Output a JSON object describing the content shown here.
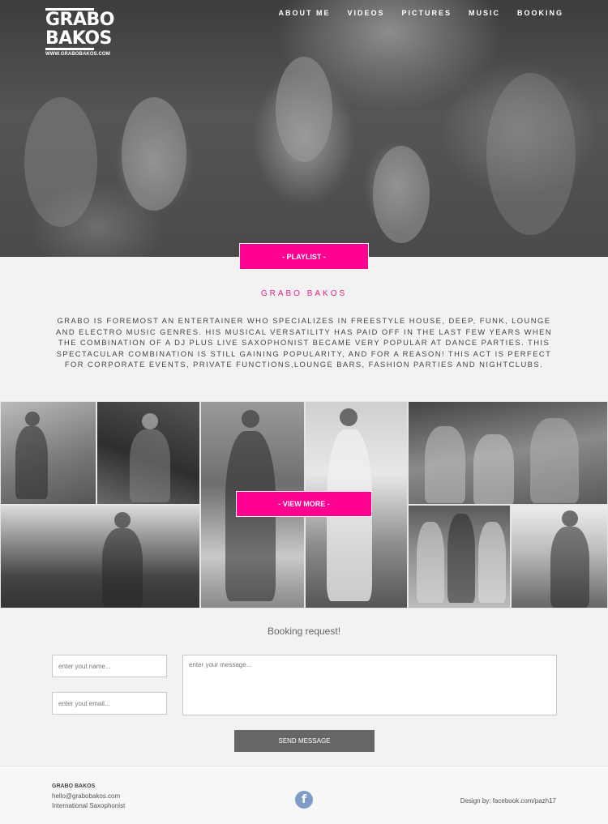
{
  "logo": {
    "line1": "GRABO",
    "line2": "BAKOS",
    "site": "WWW.GRABOBAKOS.COM"
  },
  "nav": [
    "ABOUT ME",
    "VIDEOS",
    "PICTURES",
    "MUSIC",
    "BOOKING"
  ],
  "hero": {
    "playlist_label": "- PLAYLIST -"
  },
  "about": {
    "title": "GRABO BAKOS",
    "text": "GRABO IS FOREMOST AN ENTERTAINER WHO SPECIALIZES IN FREESTYLE HOUSE, DEEP, FUNK, LOUNGE AND ELECTRO MUSIC GENRES. HIS MUSICAL VERSATILITY HAS PAID OFF IN THE LAST FEW YEARS WHEN THE COMBINATION OF A DJ PLUS LIVE SAXOPHONIST BECAME VERY POPULAR AT DANCE PARTIES. THIS SPECTACULAR COMBINATION IS STILL GAINING POPULARITY, AND FOR A REASON! THIS ACT IS PERFECT FOR CORPORATE EVENTS, PRIVATE FUNCTIONS,LOUNGE BARS, FASHION PARTIES AND NIGHTCLUBS."
  },
  "gallery": {
    "view_more_label": "- VIEW MORE -"
  },
  "booking": {
    "title": "Booking request!",
    "name_placeholder": "enter yout name...",
    "email_placeholder": "enter yout email...",
    "message_placeholder": "enter your message...",
    "send_label": "SEND MESSAGE"
  },
  "footer": {
    "brand": "GRABO BAKOS",
    "email": "hello@grabobakos.com",
    "role": "International Saxophonist",
    "facebook_glyph": "f",
    "credit": "Design by: facebook.com/pazh17"
  },
  "colors": {
    "accent": "#ff0090",
    "title_pink": "#e0218a",
    "button_grey": "#666666",
    "facebook": "#7f9cc8"
  }
}
